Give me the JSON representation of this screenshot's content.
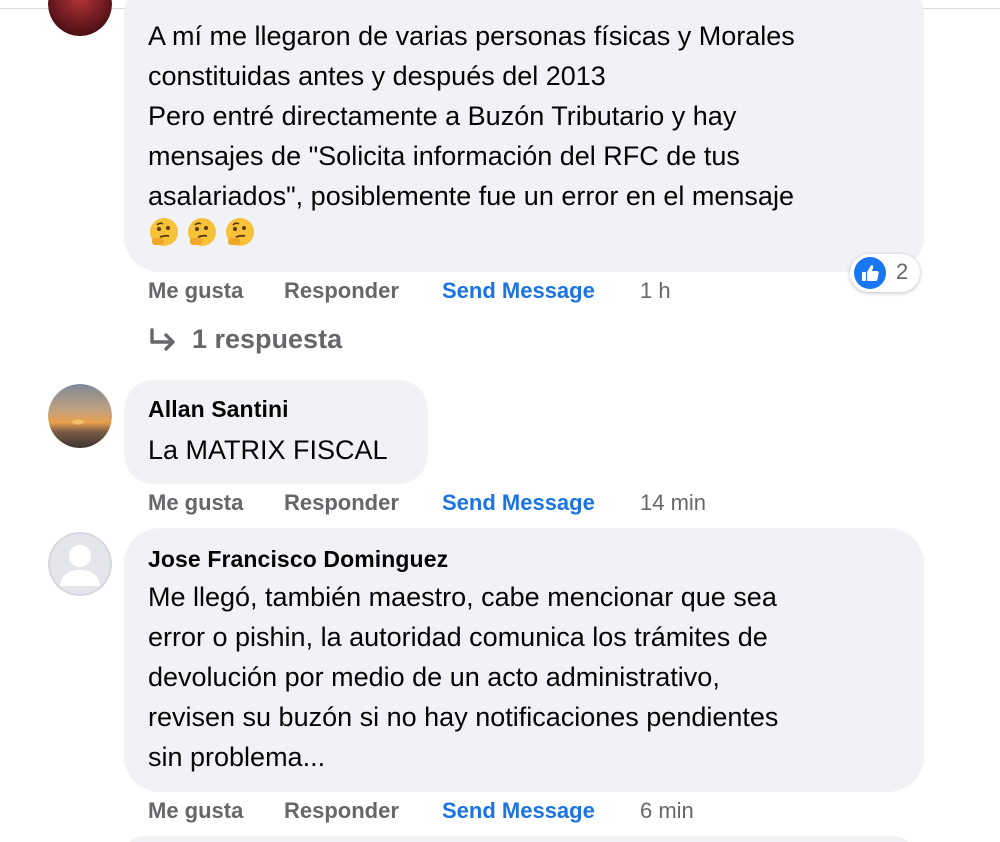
{
  "comments": [
    {
      "author": "",
      "lines": [
        "A mí me llegaron de varias personas físicas y Morales",
        "constituidas antes y después del 2013",
        "Pero entré directamente a Buzón Tributario y hay",
        "mensajes de \"Solicita información del RFC de tus",
        "asalariados\", posiblemente fue un error en el mensaje"
      ],
      "emoji_line": [
        "thinking-face-icon",
        "thinking-face-icon",
        "thinking-face-icon"
      ],
      "actions": {
        "like": "Me gusta",
        "reply": "Responder",
        "send": "Send Message",
        "time": "1 h"
      },
      "reactions": {
        "icon": "like-icon",
        "count": "2"
      },
      "replies": "1 respuesta"
    },
    {
      "author": "Allan Santini",
      "lines": [
        "La MATRIX FISCAL"
      ],
      "actions": {
        "like": "Me gusta",
        "reply": "Responder",
        "send": "Send Message",
        "time": "14 min"
      }
    },
    {
      "author": "Jose Francisco Dominguez",
      "lines": [
        "Me llegó, también maestro, cabe mencionar que sea",
        "error o pishin, la autoridad comunica los trámites de",
        "devolución por medio de un acto administrativo,",
        "revisen su buzón si no hay notificaciones pendientes",
        "sin problema..."
      ],
      "actions": {
        "like": "Me gusta",
        "reply": "Responder",
        "send": "Send Message",
        "time": "6 min"
      }
    }
  ],
  "colors": {
    "bubble": "#f0f2f5",
    "meta_text": "#65676b",
    "link": "#1b74e4",
    "like_blue": "#1877f2"
  }
}
